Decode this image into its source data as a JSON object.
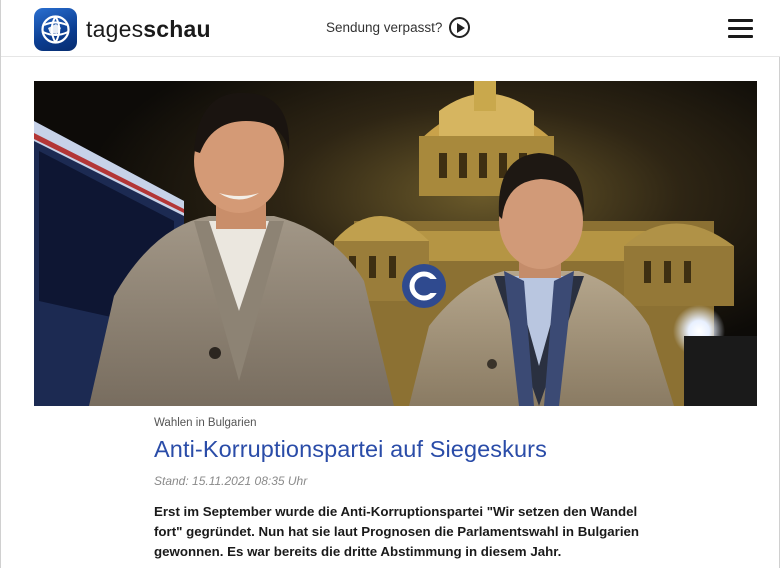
{
  "header": {
    "brand_light": "tages",
    "brand_bold": "schau",
    "missed_label": "Sendung verpasst?"
  },
  "colors": {
    "brand_blue": "#0b3d91",
    "headline_blue": "#2a4ca8",
    "background": "#ffffff"
  },
  "icons": {
    "logo": "tagesschau-globe-logo-icon",
    "play": "play-circle-icon",
    "menu": "hamburger-menu-icon"
  },
  "article": {
    "topline": "Wahlen in Bulgarien",
    "headline": "Anti-Korruptionspartei auf Siegeskurs",
    "meta": "Stand: 15.11.2021 08:35 Uhr",
    "teaser": "Erst im September wurde die Anti-Korruptionspartei \"Wir setzen den Wandel fort\" gegründet. Nun hat sie laut Prognosen die Parlamentswahl in Bulgarien gewonnen. Es war bereits die dritte Abstimmung in diesem Jahr."
  }
}
